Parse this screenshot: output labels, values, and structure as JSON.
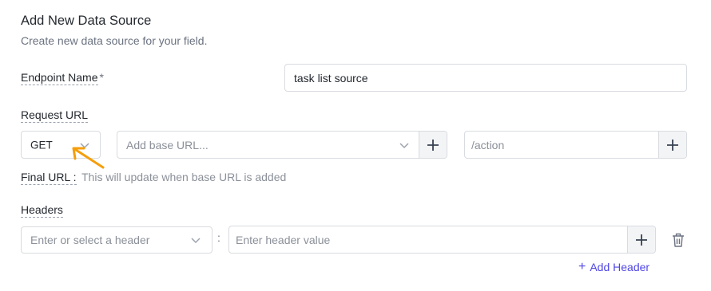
{
  "header": {
    "title": "Add New Data Source",
    "subtitle": "Create new data source for your field."
  },
  "endpoint": {
    "label": "Endpoint Name",
    "required_mark": "*",
    "value": "task list source"
  },
  "request_url": {
    "label": "Request URL",
    "method": "GET",
    "base_url_placeholder": "Add base URL...",
    "path_placeholder": "/action"
  },
  "final_url": {
    "label": "Final URL :",
    "text": "This will update when base URL is added"
  },
  "headers": {
    "label": "Headers",
    "key_placeholder": "Enter or select a header",
    "separator": ":",
    "value_placeholder": "Enter header value",
    "add_label": "Add Header",
    "add_icon": "+"
  },
  "colors": {
    "accent": "#4f46e5",
    "annotation_arrow": "#f59e0b"
  }
}
